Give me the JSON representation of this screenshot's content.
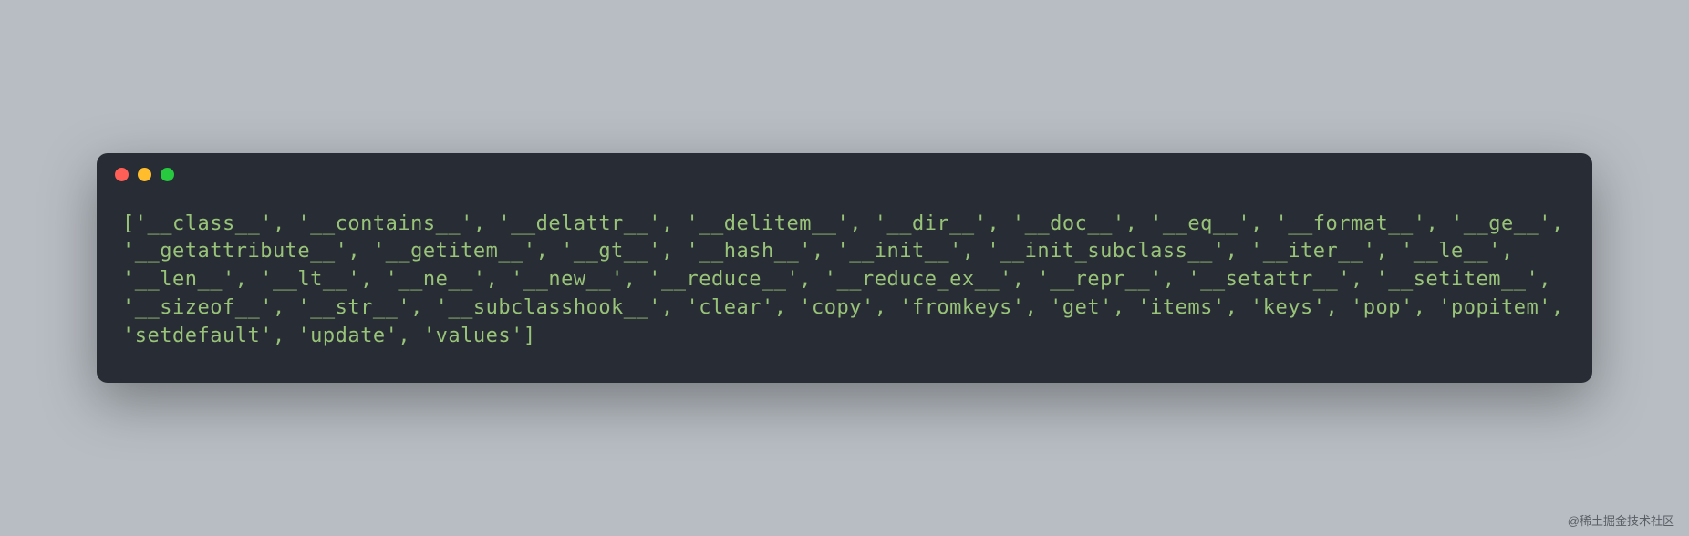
{
  "terminal": {
    "output": "['__class__', '__contains__', '__delattr__', '__delitem__', '__dir__', '__doc__', '__eq__', '__format__', '__ge__', '__getattribute__', '__getitem__', '__gt__', '__hash__', '__init__', '__init_subclass__', '__iter__', '__le__', '__len__', '__lt__', '__ne__', '__new__', '__reduce__', '__reduce_ex__', '__repr__', '__setattr__', '__setitem__', '__sizeof__', '__str__', '__subclasshook__', 'clear', 'copy', 'fromkeys', 'get', 'items', 'keys', 'pop', 'popitem', 'setdefault', 'update', 'values']"
  },
  "watermark": {
    "text": "@稀土掘金技术社区"
  }
}
